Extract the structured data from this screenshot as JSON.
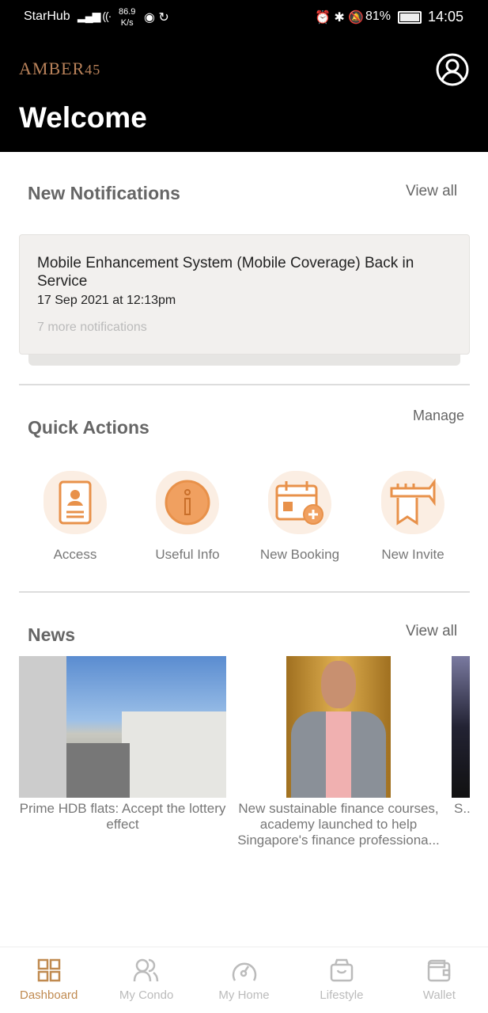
{
  "status_bar": {
    "carrier": "StarHub",
    "speed": "86.9",
    "speed_unit": "K/s",
    "battery": "81%",
    "time": "14:05"
  },
  "header": {
    "logo": "AMBER45",
    "title": "Welcome"
  },
  "notifications": {
    "title": "New Notifications",
    "view_all": "View all",
    "item": {
      "title": "Mobile Enhancement System (Mobile Coverage) Back in Service",
      "date": "17 Sep 2021 at 12:13pm"
    },
    "more": "7 more notifications"
  },
  "quick_actions": {
    "title": "Quick Actions",
    "manage": "Manage",
    "items": [
      {
        "label": "Access",
        "icon": "id-card-icon"
      },
      {
        "label": "Useful Info",
        "icon": "info-icon"
      },
      {
        "label": "New Booking",
        "icon": "calendar-add-icon"
      },
      {
        "label": "New Invite",
        "icon": "trumpet-icon"
      }
    ],
    "accent": "#e8914a"
  },
  "news": {
    "title": "News",
    "view_all": "View all",
    "items": [
      {
        "caption": "Prime HDB flats: Accept the lottery effect"
      },
      {
        "caption": "New sustainable finance courses, academy launched to help Singapore's finance professiona..."
      },
      {
        "caption": "S... bre..."
      }
    ]
  },
  "nav": {
    "active_color": "#c08a50",
    "items": [
      {
        "label": "Dashboard"
      },
      {
        "label": "My Condo"
      },
      {
        "label": "My Home"
      },
      {
        "label": "Lifestyle"
      },
      {
        "label": "Wallet"
      }
    ]
  }
}
